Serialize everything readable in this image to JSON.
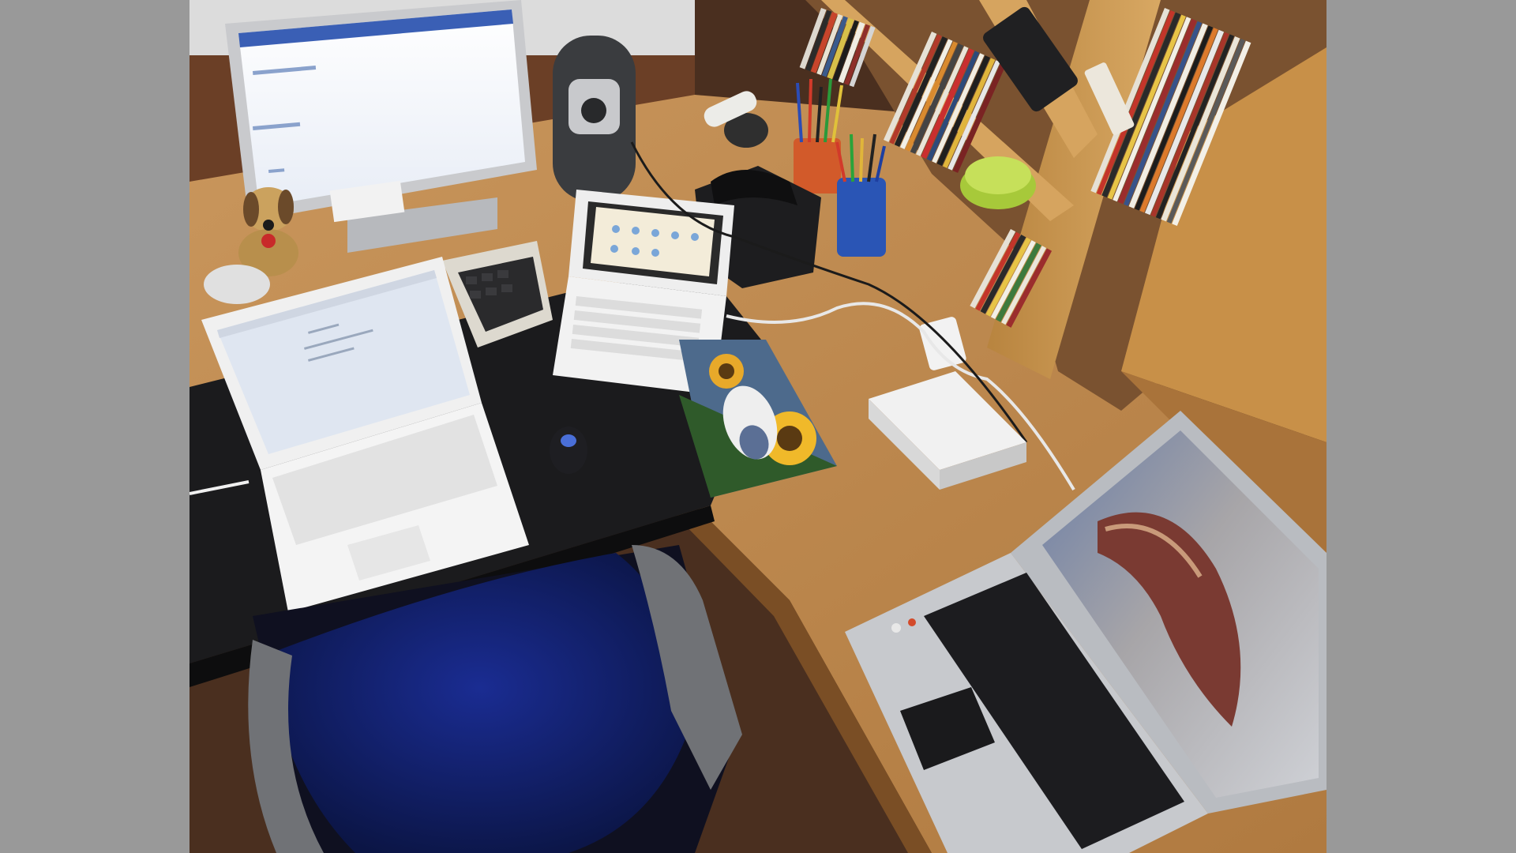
{
  "scene": {
    "subject": "desk-setup",
    "colors": {
      "letterbox": "#999999",
      "desk_wood": "#c8955a",
      "desk_wood_dark": "#a8743f",
      "black_panel": "#1b1b1d",
      "floor": "#5a3a26",
      "chair_seat": "#12206b",
      "chair_frame": "#6d6d70",
      "device_white": "#eaeaea",
      "screen_glow": "#f5f7fb",
      "aspire_body": "#bfc2c6",
      "keyboard_black": "#1c1c1f"
    }
  }
}
